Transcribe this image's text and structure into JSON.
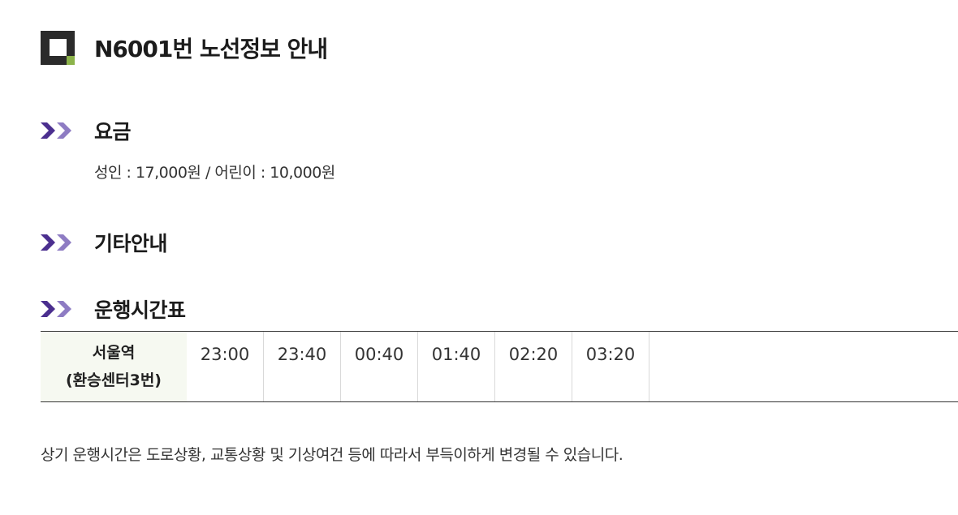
{
  "header": {
    "title": "N6001번 노선정보 안내"
  },
  "sections": {
    "fare": {
      "heading": "요금",
      "text": "성인 : 17,000원 / 어린이 : 10,000원"
    },
    "other": {
      "heading": "기타안내"
    },
    "timetable": {
      "heading": "운행시간표",
      "station_line1": "서울역",
      "station_line2": "(환승센터3번)",
      "times": [
        "23:00",
        "23:40",
        "00:40",
        "01:40",
        "02:20",
        "03:20"
      ]
    }
  },
  "notice": "상기 운행시간은 도로상황, 교통상황 및 기상여건 등에 따라서 부득이하게 변경될 수 있습니다.",
  "colors": {
    "logo_dark": "#2b2b2b",
    "logo_accent": "#8cb34a",
    "arrow_dark": "#4b2f8f",
    "arrow_light": "#8e7cc3",
    "station_bg": "#f6f9f1"
  }
}
